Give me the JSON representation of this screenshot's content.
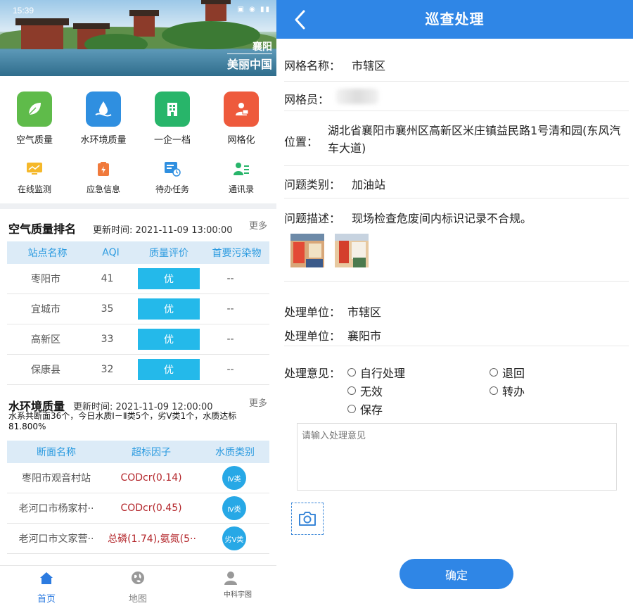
{
  "left": {
    "status_time": "15:39",
    "banner": {
      "city": "襄阳",
      "slogan": "美丽中国"
    },
    "apps": [
      {
        "label": "空气质量",
        "icon": "leaf-icon",
        "color": "#5fbb4a"
      },
      {
        "label": "水环境质量",
        "icon": "water-drop-icon",
        "color": "#2f8fe0"
      },
      {
        "label": "一企一档",
        "icon": "building-icon",
        "color": "#28b56a"
      },
      {
        "label": "网格化",
        "icon": "person-card-icon",
        "color": "#ee5a3c"
      }
    ],
    "tools": [
      {
        "label": "在线监测",
        "icon": "monitor-chart-icon",
        "color": "#f5b82a"
      },
      {
        "label": "应急信息",
        "icon": "emergency-clipboard-icon",
        "color": "#f07a3c"
      },
      {
        "label": "待办任务",
        "icon": "task-clock-icon",
        "color": "#2f8fe0"
      },
      {
        "label": "通讯录",
        "icon": "contacts-icon",
        "color": "#28b56a"
      }
    ],
    "air": {
      "title": "空气质量排名",
      "update": "更新时间: 2021-11-09 13:00:00",
      "more": "更多",
      "columns": [
        "站点名称",
        "AQI",
        "质量评价",
        "首要污染物"
      ],
      "rows": [
        {
          "name": "枣阳市",
          "aqi": "41",
          "grade": "优",
          "pollutant": "--"
        },
        {
          "name": "宜城市",
          "aqi": "35",
          "grade": "优",
          "pollutant": "--"
        },
        {
          "name": "高新区",
          "aqi": "33",
          "grade": "优",
          "pollutant": "--"
        },
        {
          "name": "保康县",
          "aqi": "32",
          "grade": "优",
          "pollutant": "--"
        }
      ]
    },
    "water": {
      "title": "水环境质量",
      "update": "更新时间: 2021-11-09 12:00:00",
      "more": "更多",
      "summary": "水系共断面36个，今日水质Ⅰ－Ⅱ类5个，劣V类1个，水质达标81.800%",
      "columns": [
        "断面名称",
        "超标因子",
        "水质类别"
      ],
      "rows": [
        {
          "name": "枣阳市观音村站",
          "factor": "CODcr(0.14)",
          "class": "Ⅳ类"
        },
        {
          "name": "老河口市杨家村··",
          "factor": "CODcr(0.45)",
          "class": "Ⅳ类"
        },
        {
          "name": "老河口市文家营··",
          "factor": "总磷(1.74),氨氮(5··",
          "class": "劣Ⅴ类"
        }
      ]
    },
    "nav": [
      {
        "label": "首页",
        "icon": "home-icon"
      },
      {
        "label": "地图",
        "icon": "map-globe-icon"
      },
      {
        "label": "",
        "icon": "user-icon"
      }
    ],
    "watermark": "中科宇图"
  },
  "right": {
    "title": "巡查处理",
    "fields": {
      "grid_name_label": "网格名称：",
      "grid_name": "市辖区",
      "grid_member_label": "网格员：",
      "location_label": "位置：",
      "location": "湖北省襄阳市襄州区高新区米庄镇益民路1号清和园(东风汽车大道)",
      "category_label": "问题类别：",
      "category": "加油站",
      "description_label": "问题描述：",
      "description": "现场检查危废间内标识记录不合规。",
      "unit1_label": "处理单位：",
      "unit1": "市辖区",
      "unit2_label": "处理单位：",
      "unit2": "襄阳市"
    },
    "opinion": {
      "label": "处理意见：",
      "options": [
        "自行处理",
        "退回",
        "无效",
        "转办",
        "保存"
      ],
      "placeholder": "请输入处理意见"
    },
    "confirm_label": "确定"
  }
}
